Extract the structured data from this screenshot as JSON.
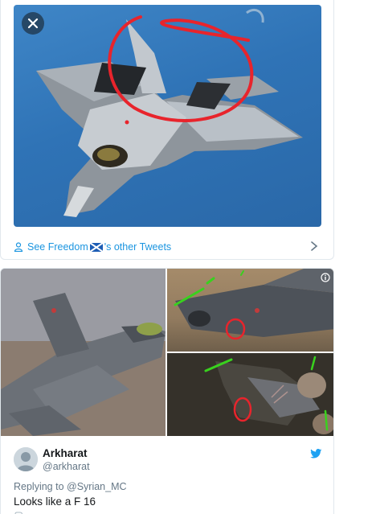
{
  "top_tweet": {
    "see_more_prefix": "See Freedom",
    "see_more_suffix": "'s other Tweets"
  },
  "bottom_tweet": {
    "display_name": "Arkharat",
    "handle": "@arkharat",
    "replying_to": "Replying to @Syrian_MC",
    "text": "Looks like a F 16"
  },
  "icons": {
    "close": "close-icon",
    "person": "person-icon",
    "flag": "scotland-flag-icon",
    "chevron": "chevron-right-icon",
    "info": "info-icon",
    "bird": "twitter-bird-icon",
    "reply": "reply-icon"
  },
  "colors": {
    "link": "#1b95e0",
    "secondary_text": "#657786",
    "annotation_red": "#e8242c",
    "annotation_green": "#39d11e"
  }
}
